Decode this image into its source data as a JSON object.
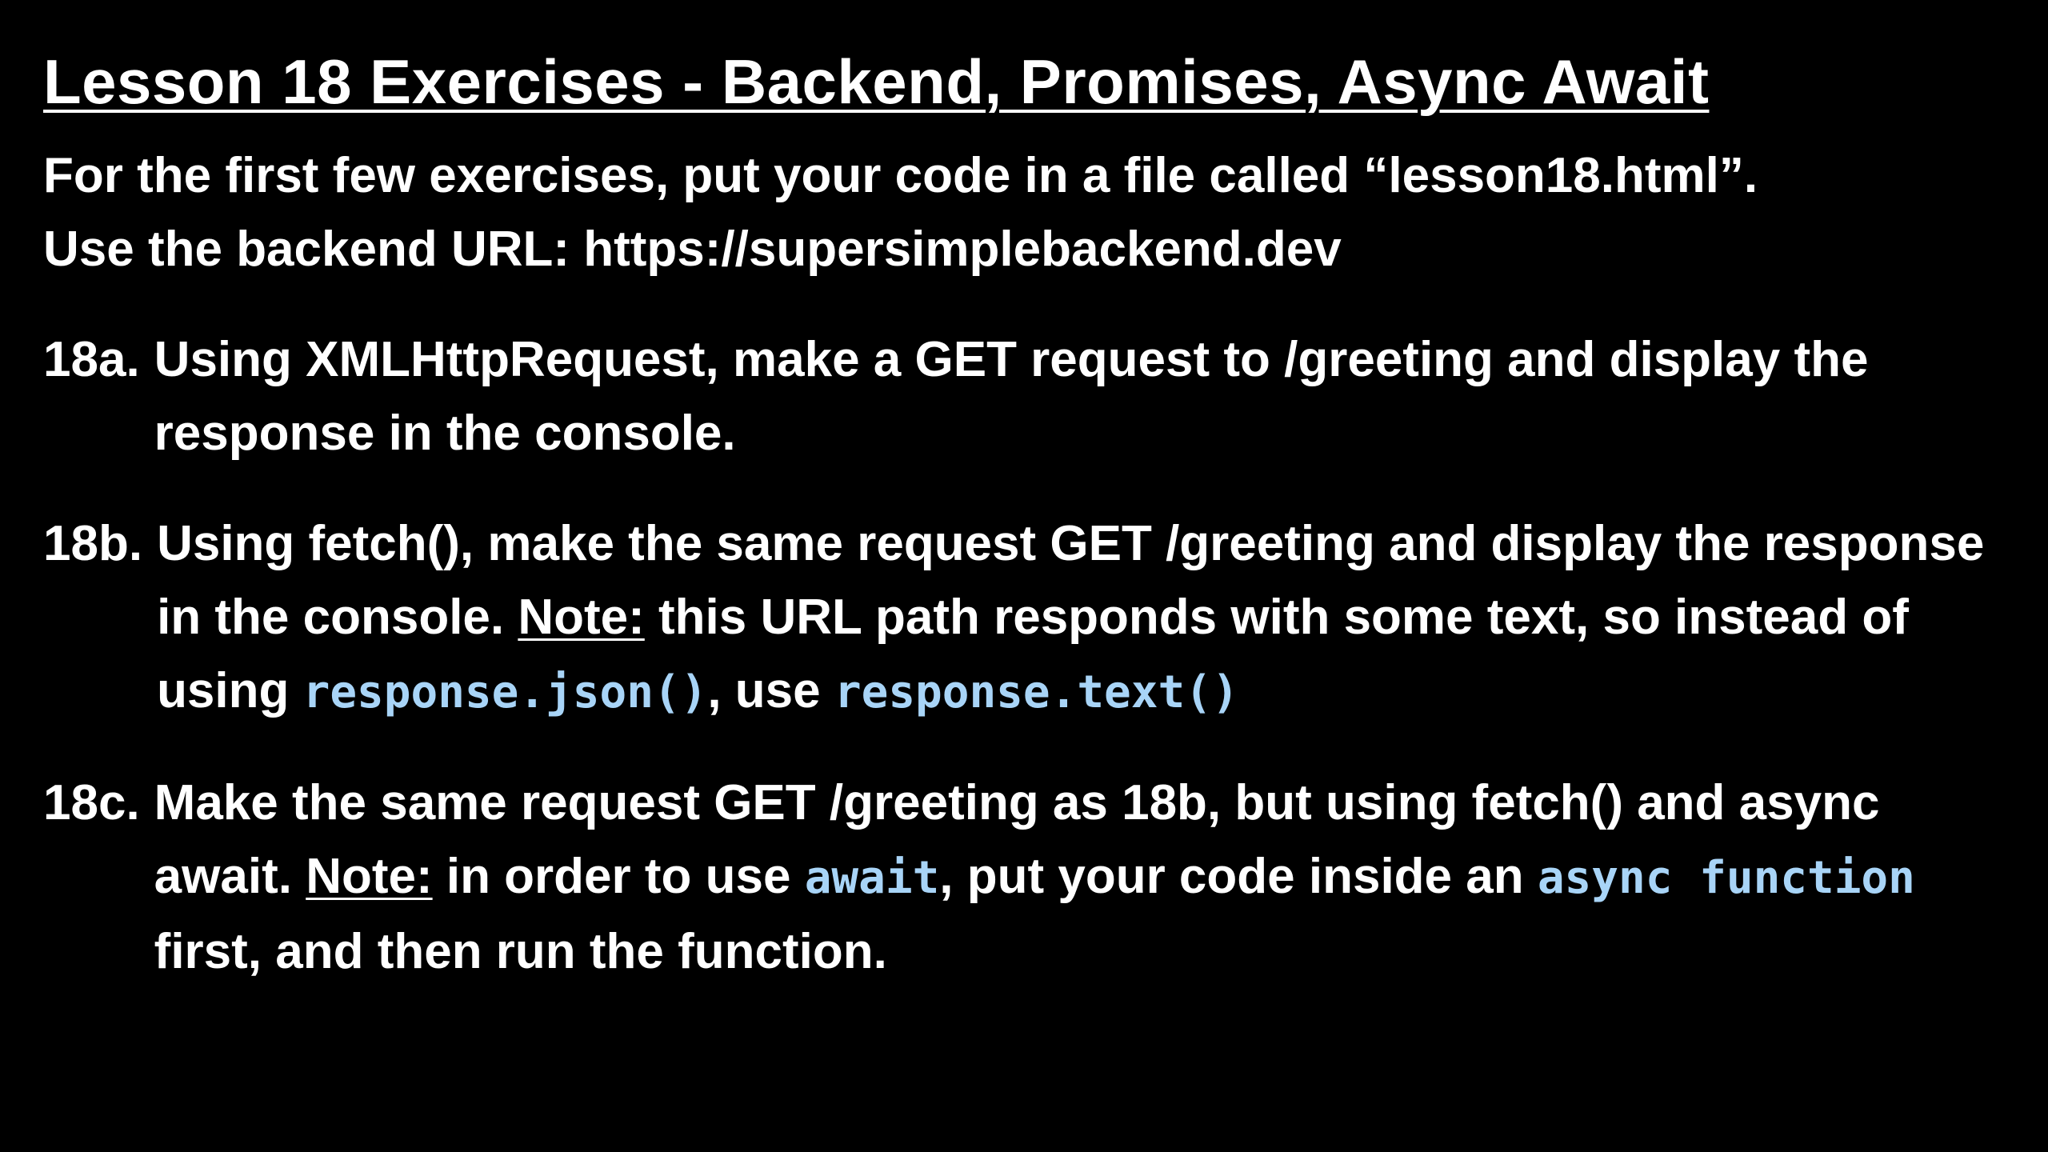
{
  "title": "Lesson 18 Exercises - Backend, Promises, Async Await",
  "intro": {
    "line1": "For the first few exercises, put your code in a file called “lesson18.html”.",
    "line2": "Use the backend URL: https://supersimplebackend.dev"
  },
  "exercises": [
    {
      "label": "18a.",
      "text": "Using XMLHttpRequest, make a GET request to /greeting and display the response in the console."
    },
    {
      "label": "18b.",
      "text1": "Using fetch(), make the same request GET /greeting and display the response in the console.",
      "note": "Note:",
      "text2": "this URL path responds with some text, so instead of using",
      "code1": "response.json()",
      "text3": ", use",
      "code2": "response.text()"
    },
    {
      "label": "18c.",
      "text1": "Make the same request GET /greeting as 18b, but using fetch() and async await.",
      "note": "Note:",
      "text2": "in order to use",
      "code1": "await",
      "text3": ", put your code inside an",
      "code2": "async function",
      "text4": "first, and then run the function."
    }
  ]
}
